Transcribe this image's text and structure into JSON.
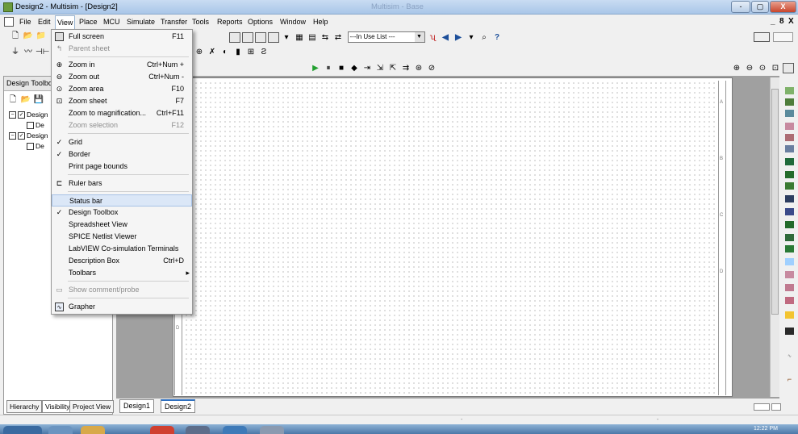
{
  "window": {
    "title": "Design2 - Multisim - [Design2]",
    "ghost_title": "Multisim - Base",
    "buttons": [
      "-",
      "▢",
      "X"
    ]
  },
  "menubar": {
    "items": [
      "File",
      "Edit",
      "View",
      "Place",
      "MCU",
      "Simulate",
      "Transfer",
      "Tools",
      "Reports",
      "Options",
      "Window",
      "Help"
    ],
    "mdi_controls": [
      "_",
      "8",
      "X"
    ]
  },
  "toolbar": {
    "in_use_list": "---In Use List ---"
  },
  "left_panel": {
    "title": "Design Toolbo",
    "tree": [
      "Design",
      "De",
      "Design",
      "De"
    ],
    "tabs": [
      "Hierarchy",
      "Visibility",
      "Project View"
    ]
  },
  "doc_tabs": [
    "Design1",
    "Design2"
  ],
  "view_menu": {
    "items": [
      {
        "label": "Full screen",
        "shortcut": "F11",
        "icon": "fullscreen-icon",
        "state": "normal"
      },
      {
        "label": "Parent sheet",
        "shortcut": "",
        "icon": "parent-sheet-icon",
        "state": "disabled"
      },
      {
        "label": "Zoom in",
        "shortcut": "Ctrl+Num +",
        "icon": "zoom-in-icon",
        "state": "normal"
      },
      {
        "label": "Zoom out",
        "shortcut": "Ctrl+Num -",
        "icon": "zoom-out-icon",
        "state": "normal"
      },
      {
        "label": "Zoom area",
        "shortcut": "F10",
        "icon": "zoom-area-icon",
        "state": "normal"
      },
      {
        "label": "Zoom sheet",
        "shortcut": "F7",
        "icon": "zoom-sheet-icon",
        "state": "normal"
      },
      {
        "label": "Zoom to magnification...",
        "shortcut": "Ctrl+F11",
        "icon": "",
        "state": "normal"
      },
      {
        "label": "Zoom selection",
        "shortcut": "F12",
        "icon": "",
        "state": "disabled"
      },
      {
        "label": "Grid",
        "shortcut": "",
        "icon": "check-icon",
        "state": "checked"
      },
      {
        "label": "Border",
        "shortcut": "",
        "icon": "check-icon",
        "state": "checked"
      },
      {
        "label": "Print page bounds",
        "shortcut": "",
        "icon": "",
        "state": "normal"
      },
      {
        "label": "Ruler bars",
        "shortcut": "",
        "icon": "ruler-icon",
        "state": "normal"
      },
      {
        "label": "Status bar",
        "shortcut": "",
        "icon": "",
        "state": "highlighted"
      },
      {
        "label": "Design Toolbox",
        "shortcut": "",
        "icon": "check-icon",
        "state": "checked"
      },
      {
        "label": "Spreadsheet View",
        "shortcut": "",
        "icon": "",
        "state": "normal"
      },
      {
        "label": "SPICE Netlist Viewer",
        "shortcut": "",
        "icon": "",
        "state": "normal"
      },
      {
        "label": "LabVIEW Co-simulation Terminals",
        "shortcut": "",
        "icon": "",
        "state": "normal"
      },
      {
        "label": "Description Box",
        "shortcut": "Ctrl+D",
        "icon": "",
        "state": "normal"
      },
      {
        "label": "Toolbars",
        "shortcut": "▸",
        "icon": "",
        "state": "normal"
      },
      {
        "label": "Show comment/probe",
        "shortcut": "",
        "icon": "comment-icon",
        "state": "disabled"
      },
      {
        "label": "Grapher",
        "shortcut": "",
        "icon": "grapher-icon",
        "state": "normal"
      }
    ]
  },
  "ruler_letters": [
    "A",
    "B",
    "C",
    "D"
  ],
  "taskbar": {
    "clock": "12:22 PM"
  }
}
